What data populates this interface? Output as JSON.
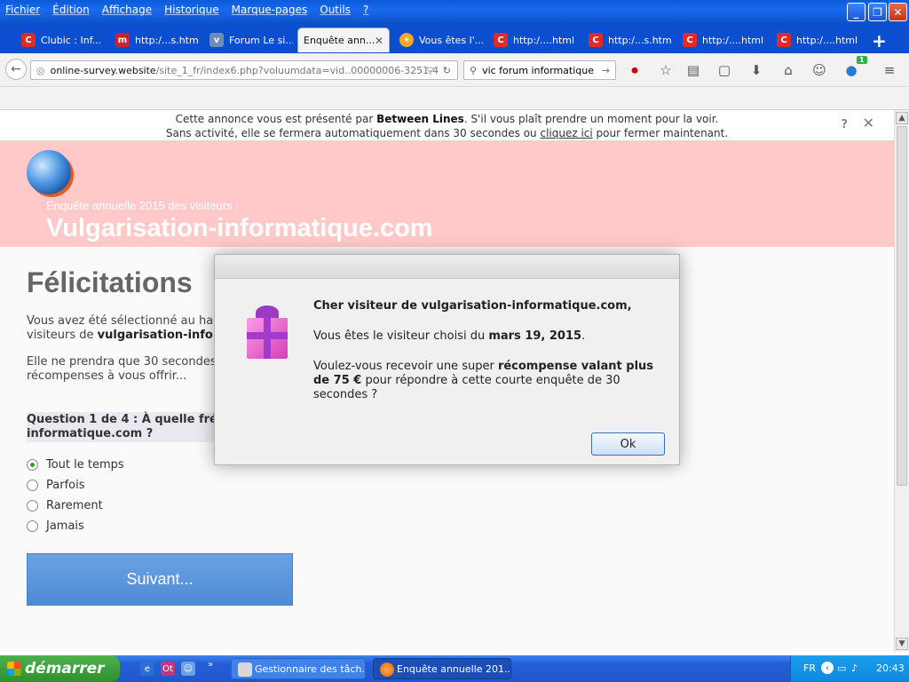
{
  "menu": [
    "Fichier",
    "Édition",
    "Affichage",
    "Historique",
    "Marque-pages",
    "Outils",
    "?"
  ],
  "tabs": [
    {
      "label": "Clubic : Inf...",
      "icon": "clubic-icon"
    },
    {
      "label": "http:/...s.html",
      "icon": "m-site-icon"
    },
    {
      "label": "Forum Le si...",
      "icon": "forum-icon"
    },
    {
      "label": "Enquête ann...",
      "icon": "",
      "active": true
    },
    {
      "label": "Vous êtes l'...",
      "icon": "sun-icon"
    },
    {
      "label": "http:/....html",
      "icon": "clubic-icon"
    },
    {
      "label": "http:/...s.html",
      "icon": "clubic-icon"
    },
    {
      "label": "http:/....html",
      "icon": "clubic-icon"
    },
    {
      "label": "http:/....html",
      "icon": "clubic-icon"
    }
  ],
  "url": {
    "host": "online-survey.website",
    "path": "/site_1_fr/index6.php?voluumdata=vid..00000006-3251-4"
  },
  "search": {
    "value": "vic forum informatique"
  },
  "badge_count": "1",
  "ad": {
    "line1_pre": "Cette annonce vous est présenté par ",
    "line1_brand": "Between Lines",
    "line1_post": ". S'il vous plaît prendre un moment pour la voir.",
    "line2_pre": "Sans activité, elle se fermera automatiquement dans 30 secondes ou ",
    "line2_link": "cliquez ici",
    "line2_post": " pour fermer maintenant.",
    "help": "?",
    "close": "✕"
  },
  "hero": {
    "subtitle": "Enquête annuelle 2015 des visiteurs :",
    "title": "Vulgarisation-informatique.com"
  },
  "content": {
    "heading": "Félicitations",
    "p1_a": "Vous avez été sélectionné au ha",
    "p1_b": "visiteurs de ",
    "p1_bold": "vulgarisation-info",
    "p2_a": "Elle ne prendra que 30 secondes",
    "p2_b": "récompenses à vous offrir...",
    "question_a": "Question 1 de 4 : À quelle fré",
    "question_b": "informatique.com ?",
    "options": [
      "Tout le temps",
      "Parfois",
      "Rarement",
      "Jamais"
    ],
    "next_label": "Suivant..."
  },
  "modal": {
    "greeting": "Cher visiteur de vulgarisation-informatique.com,",
    "chosen_pre": "Vous êtes le visiteur choisi du ",
    "chosen_date": "mars 19, 2015",
    "chosen_post": ".",
    "offer_pre": "Voulez-vous recevoir une super ",
    "offer_bold": "récompense valant plus de 75 €",
    "offer_post": " pour répondre à cette courte enquête de 30 secondes ?",
    "ok_label": "Ok"
  },
  "taskbar": {
    "start": "démarrer",
    "buttons": [
      "Gestionnaire des tâch...",
      "Enquête annuelle 201..."
    ],
    "lang": "FR",
    "time": "20:43"
  }
}
